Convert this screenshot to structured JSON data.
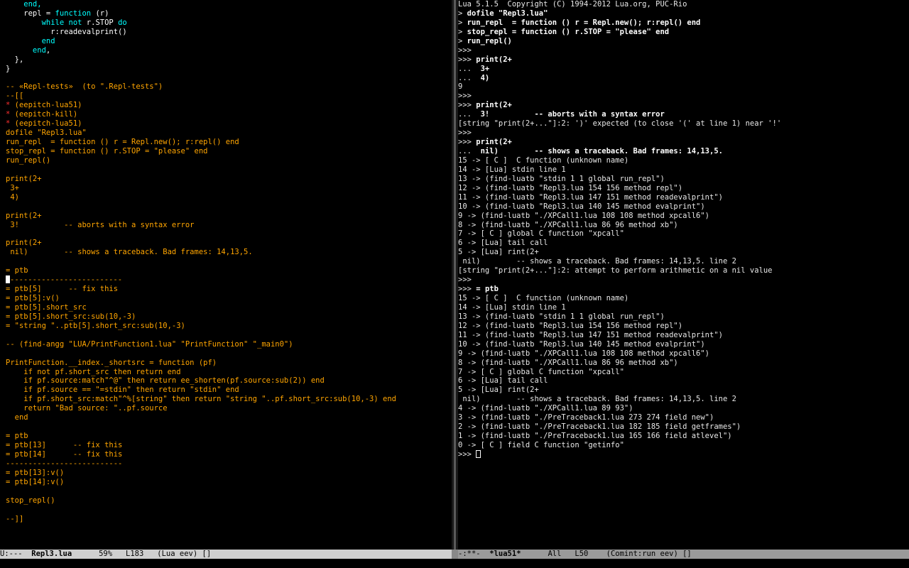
{
  "left_buffer": {
    "lines": [
      {
        "parts": [
          {
            "t": "    end,",
            "c": "c-kw"
          }
        ]
      },
      {
        "parts": [
          {
            "t": "    repl = ",
            "c": "c-code"
          },
          {
            "t": "function",
            "c": "c-kw"
          },
          {
            "t": " (r)",
            "c": "c-code"
          }
        ]
      },
      {
        "parts": [
          {
            "t": "        ",
            "c": "c-code"
          },
          {
            "t": "while not",
            "c": "c-kw"
          },
          {
            "t": " r.STOP ",
            "c": "c-code"
          },
          {
            "t": "do",
            "c": "c-kw"
          }
        ]
      },
      {
        "parts": [
          {
            "t": "          r:readevalprint()",
            "c": "c-code"
          }
        ]
      },
      {
        "parts": [
          {
            "t": "        end",
            "c": "c-kw"
          }
        ]
      },
      {
        "parts": [
          {
            "t": "      end",
            "c": "c-kw"
          },
          {
            "t": ",",
            "c": "c-code"
          }
        ]
      },
      {
        "parts": [
          {
            "t": "  },",
            "c": "c-code"
          }
        ]
      },
      {
        "parts": [
          {
            "t": "}",
            "c": "c-code"
          }
        ]
      },
      {
        "parts": [
          {
            "t": "",
            "c": "c-code"
          }
        ]
      },
      {
        "parts": [
          {
            "t": "-- «Repl-tests»  (to \".Repl-tests\")",
            "c": "c-com"
          }
        ]
      },
      {
        "parts": [
          {
            "t": "--[[",
            "c": "c-com"
          }
        ]
      },
      {
        "parts": [
          {
            "t": "*",
            "c": "c-red"
          },
          {
            "t": " (eepitch-lua51)",
            "c": "c-com"
          }
        ]
      },
      {
        "parts": [
          {
            "t": "*",
            "c": "c-red"
          },
          {
            "t": " (eepitch-kill)",
            "c": "c-com"
          }
        ]
      },
      {
        "parts": [
          {
            "t": "*",
            "c": "c-red"
          },
          {
            "t": " (eepitch-lua51)",
            "c": "c-com"
          }
        ]
      },
      {
        "parts": [
          {
            "t": "dofile \"Repl3.lua\"",
            "c": "c-com"
          }
        ]
      },
      {
        "parts": [
          {
            "t": "run_repl  = function () r = Repl.new(); r:repl() end",
            "c": "c-com"
          }
        ]
      },
      {
        "parts": [
          {
            "t": "stop_repl = function () r.STOP = \"please\" end",
            "c": "c-com"
          }
        ]
      },
      {
        "parts": [
          {
            "t": "run_repl()",
            "c": "c-com"
          }
        ]
      },
      {
        "parts": [
          {
            "t": "",
            "c": "c-com"
          }
        ]
      },
      {
        "parts": [
          {
            "t": "print(2+",
            "c": "c-com"
          }
        ]
      },
      {
        "parts": [
          {
            "t": " 3+",
            "c": "c-com"
          }
        ]
      },
      {
        "parts": [
          {
            "t": " 4)",
            "c": "c-com"
          }
        ]
      },
      {
        "parts": [
          {
            "t": "",
            "c": "c-com"
          }
        ]
      },
      {
        "parts": [
          {
            "t": "print(2+",
            "c": "c-com"
          }
        ]
      },
      {
        "parts": [
          {
            "t": " 3!          -- aborts with a syntax error",
            "c": "c-com"
          }
        ]
      },
      {
        "parts": [
          {
            "t": "",
            "c": "c-com"
          }
        ]
      },
      {
        "parts": [
          {
            "t": "print(2+",
            "c": "c-com"
          }
        ]
      },
      {
        "parts": [
          {
            "t": " nil)        -- shows a traceback. Bad frames: 14,13,5.",
            "c": "c-com"
          }
        ]
      },
      {
        "parts": [
          {
            "t": "",
            "c": "c-com"
          }
        ]
      },
      {
        "parts": [
          {
            "t": "= ptb",
            "c": "c-com"
          }
        ]
      },
      {
        "parts": [
          {
            "t": "",
            "c": "c-com",
            "cursor": true
          },
          {
            "t": "-------------------------",
            "c": "c-com"
          }
        ]
      },
      {
        "parts": [
          {
            "t": "= ptb[5]      -- fix this",
            "c": "c-com"
          }
        ]
      },
      {
        "parts": [
          {
            "t": "= ptb[5]:v()",
            "c": "c-com"
          }
        ]
      },
      {
        "parts": [
          {
            "t": "= ptb[5].short_src",
            "c": "c-com"
          }
        ]
      },
      {
        "parts": [
          {
            "t": "= ptb[5].short_src:sub(10,-3)",
            "c": "c-com"
          }
        ]
      },
      {
        "parts": [
          {
            "t": "= \"string \"..ptb[5].short_src:sub(10,-3)",
            "c": "c-com"
          }
        ]
      },
      {
        "parts": [
          {
            "t": "",
            "c": "c-com"
          }
        ]
      },
      {
        "parts": [
          {
            "t": "-- (find-angg \"LUA/PrintFunction1.lua\" \"PrintFunction\" \"_main0\")",
            "c": "c-com"
          }
        ]
      },
      {
        "parts": [
          {
            "t": "",
            "c": "c-com"
          }
        ]
      },
      {
        "parts": [
          {
            "t": "PrintFunction.__index._shortsrc = function (pf)",
            "c": "c-com"
          }
        ]
      },
      {
        "parts": [
          {
            "t": "    if not pf.short_src then return end",
            "c": "c-com"
          }
        ]
      },
      {
        "parts": [
          {
            "t": "    if pf.source:match\"^@\" then return ee_shorten(pf.source:sub(2)) end",
            "c": "c-com"
          }
        ]
      },
      {
        "parts": [
          {
            "t": "    if pf.source == \"=stdin\" then return \"stdin\" end",
            "c": "c-com"
          }
        ]
      },
      {
        "parts": [
          {
            "t": "    if pf.short_src:match\"^%[string\" then return \"string \"..pf.short_src:sub(10,-3) end",
            "c": "c-com"
          }
        ]
      },
      {
        "parts": [
          {
            "t": "    return \"Bad source: \"..pf.source",
            "c": "c-com"
          }
        ]
      },
      {
        "parts": [
          {
            "t": "  end",
            "c": "c-com"
          }
        ]
      },
      {
        "parts": [
          {
            "t": "",
            "c": "c-com"
          }
        ]
      },
      {
        "parts": [
          {
            "t": "= ptb",
            "c": "c-com"
          }
        ]
      },
      {
        "parts": [
          {
            "t": "= ptb[13]      -- fix this",
            "c": "c-com"
          }
        ]
      },
      {
        "parts": [
          {
            "t": "= ptb[14]      -- fix this",
            "c": "c-com"
          }
        ]
      },
      {
        "parts": [
          {
            "t": "--------------------------",
            "c": "c-com"
          }
        ]
      },
      {
        "parts": [
          {
            "t": "= ptb[13]:v()",
            "c": "c-com"
          }
        ]
      },
      {
        "parts": [
          {
            "t": "= ptb[14]:v()",
            "c": "c-com"
          }
        ]
      },
      {
        "parts": [
          {
            "t": "",
            "c": "c-com"
          }
        ]
      },
      {
        "parts": [
          {
            "t": "stop_repl()",
            "c": "c-com"
          }
        ]
      },
      {
        "parts": [
          {
            "t": "",
            "c": "c-com"
          }
        ]
      },
      {
        "parts": [
          {
            "t": "--]]",
            "c": "c-com"
          }
        ]
      }
    ]
  },
  "right_buffer": {
    "lines": [
      {
        "parts": [
          {
            "t": "Lua 5.1.5  Copyright (C) 1994-2012 Lua.org, PUC-Rio",
            "c": "c-out"
          }
        ]
      },
      {
        "parts": [
          {
            "t": "> ",
            "c": "c-out"
          },
          {
            "t": "dofile \"Repl3.lua\"",
            "c": "c-bold"
          }
        ]
      },
      {
        "parts": [
          {
            "t": "> ",
            "c": "c-out"
          },
          {
            "t": "run_repl  = function () r = Repl.new(); r:repl() end",
            "c": "c-bold"
          }
        ]
      },
      {
        "parts": [
          {
            "t": "> ",
            "c": "c-out"
          },
          {
            "t": "stop_repl = function () r.STOP = \"please\" end",
            "c": "c-bold"
          }
        ]
      },
      {
        "parts": [
          {
            "t": "> ",
            "c": "c-out"
          },
          {
            "t": "run_repl()",
            "c": "c-bold"
          }
        ]
      },
      {
        "parts": [
          {
            "t": ">>>",
            "c": "c-out"
          }
        ]
      },
      {
        "parts": [
          {
            "t": ">>> ",
            "c": "c-out"
          },
          {
            "t": "print(2+",
            "c": "c-bold"
          }
        ]
      },
      {
        "parts": [
          {
            "t": "...  ",
            "c": "c-out"
          },
          {
            "t": "3+",
            "c": "c-bold"
          }
        ]
      },
      {
        "parts": [
          {
            "t": "...  ",
            "c": "c-out"
          },
          {
            "t": "4)",
            "c": "c-bold"
          }
        ]
      },
      {
        "parts": [
          {
            "t": "9",
            "c": "c-out"
          }
        ]
      },
      {
        "parts": [
          {
            "t": ">>>",
            "c": "c-out"
          }
        ]
      },
      {
        "parts": [
          {
            "t": ">>> ",
            "c": "c-out"
          },
          {
            "t": "print(2+",
            "c": "c-bold"
          }
        ]
      },
      {
        "parts": [
          {
            "t": "...  ",
            "c": "c-out"
          },
          {
            "t": "3!          -- aborts with a syntax error",
            "c": "c-bold"
          }
        ]
      },
      {
        "parts": [
          {
            "t": "[string \"print(2+...\"]:2: ')' expected (to close '(' at line 1) near '!'",
            "c": "c-out"
          }
        ]
      },
      {
        "parts": [
          {
            "t": ">>>",
            "c": "c-out"
          }
        ]
      },
      {
        "parts": [
          {
            "t": ">>> ",
            "c": "c-out"
          },
          {
            "t": "print(2+",
            "c": "c-bold"
          }
        ]
      },
      {
        "parts": [
          {
            "t": "...  ",
            "c": "c-out"
          },
          {
            "t": "nil)        -- shows a traceback. Bad frames: 14,13,5.",
            "c": "c-bold"
          }
        ]
      },
      {
        "parts": [
          {
            "t": "15 -> [ C ]  C function (unknown name)",
            "c": "c-out"
          }
        ]
      },
      {
        "parts": [
          {
            "t": "14 -> [Lua] stdin line 1",
            "c": "c-out"
          }
        ]
      },
      {
        "parts": [
          {
            "t": "13 -> (find-luatb \"stdin 1 1 global run_repl\")",
            "c": "c-out"
          }
        ]
      },
      {
        "parts": [
          {
            "t": "12 -> (find-luatb \"Repl3.lua 154 156 method repl\")",
            "c": "c-out"
          }
        ]
      },
      {
        "parts": [
          {
            "t": "11 -> (find-luatb \"Repl3.lua 147 151 method readevalprint\")",
            "c": "c-out"
          }
        ]
      },
      {
        "parts": [
          {
            "t": "10 -> (find-luatb \"Repl3.lua 140 145 method evalprint\")",
            "c": "c-out"
          }
        ]
      },
      {
        "parts": [
          {
            "t": "9 -> (find-luatb \"./XPCall1.lua 108 108 method xpcall6\")",
            "c": "c-out"
          }
        ]
      },
      {
        "parts": [
          {
            "t": "8 -> (find-luatb \"./XPCall1.lua 86 96 method xb\")",
            "c": "c-out"
          }
        ]
      },
      {
        "parts": [
          {
            "t": "7 -> [ C ] global C function \"xpcall\"",
            "c": "c-out"
          }
        ]
      },
      {
        "parts": [
          {
            "t": "6 -> [Lua] tail call",
            "c": "c-out"
          }
        ]
      },
      {
        "parts": [
          {
            "t": "5 -> [Lua] rint(2+",
            "c": "c-out"
          }
        ]
      },
      {
        "parts": [
          {
            "t": " nil)        -- shows a traceback. Bad frames: 14,13,5. line 2",
            "c": "c-out"
          }
        ]
      },
      {
        "parts": [
          {
            "t": "[string \"print(2+...\"]:2: attempt to perform arithmetic on a nil value",
            "c": "c-out"
          }
        ]
      },
      {
        "parts": [
          {
            "t": ">>>",
            "c": "c-out"
          }
        ]
      },
      {
        "parts": [
          {
            "t": ">>> ",
            "c": "c-out"
          },
          {
            "t": "= ptb",
            "c": "c-bold"
          }
        ]
      },
      {
        "parts": [
          {
            "t": "15 -> [ C ]  C function (unknown name)",
            "c": "c-out"
          }
        ]
      },
      {
        "parts": [
          {
            "t": "14 -> [Lua] stdin line 1",
            "c": "c-out"
          }
        ]
      },
      {
        "parts": [
          {
            "t": "13 -> (find-luatb \"stdin 1 1 global run_repl\")",
            "c": "c-out"
          }
        ]
      },
      {
        "parts": [
          {
            "t": "12 -> (find-luatb \"Repl3.lua 154 156 method repl\")",
            "c": "c-out"
          }
        ]
      },
      {
        "parts": [
          {
            "t": "11 -> (find-luatb \"Repl3.lua 147 151 method readevalprint\")",
            "c": "c-out"
          }
        ]
      },
      {
        "parts": [
          {
            "t": "10 -> (find-luatb \"Repl3.lua 140 145 method evalprint\")",
            "c": "c-out"
          }
        ]
      },
      {
        "parts": [
          {
            "t": "9 -> (find-luatb \"./XPCall1.lua 108 108 method xpcall6\")",
            "c": "c-out"
          }
        ]
      },
      {
        "parts": [
          {
            "t": "8 -> (find-luatb \"./XPCall1.lua 86 96 method xb\")",
            "c": "c-out"
          }
        ]
      },
      {
        "parts": [
          {
            "t": "7 -> [ C ] global C function \"xpcall\"",
            "c": "c-out"
          }
        ]
      },
      {
        "parts": [
          {
            "t": "6 -> [Lua] tail call",
            "c": "c-out"
          }
        ]
      },
      {
        "parts": [
          {
            "t": "5 -> [Lua] rint(2+",
            "c": "c-out"
          }
        ]
      },
      {
        "parts": [
          {
            "t": " nil)        -- shows a traceback. Bad frames: 14,13,5. line 2",
            "c": "c-out"
          }
        ]
      },
      {
        "parts": [
          {
            "t": "4 -> (find-luatb \"./XPCall1.lua 89 93\")",
            "c": "c-out"
          }
        ]
      },
      {
        "parts": [
          {
            "t": "3 -> (find-luatb \"./PreTraceback1.lua 273 274 field new\")",
            "c": "c-out"
          }
        ]
      },
      {
        "parts": [
          {
            "t": "2 -> (find-luatb \"./PreTraceback1.lua 182 185 field getframes\")",
            "c": "c-out"
          }
        ]
      },
      {
        "parts": [
          {
            "t": "1 -> (find-luatb \"./PreTraceback1.lua 165 166 field atlevel\")",
            "c": "c-out"
          }
        ]
      },
      {
        "parts": [
          {
            "t": "0 -> [ C ] field C function \"getinfo\"",
            "c": "c-out"
          }
        ]
      },
      {
        "parts": [
          {
            "t": ">>> ",
            "c": "c-out",
            "cursor": true
          }
        ]
      }
    ]
  },
  "modeline_left": {
    "status": "U:---  ",
    "buffer": "Repl3.lua",
    "rest": "      59%   L183   (Lua eev) []"
  },
  "modeline_right": {
    "status": "-:**-  ",
    "buffer": "*lua51*",
    "rest": "      All   L50    (Comint:run eev) []"
  },
  "colors": {
    "background": "#000000",
    "code": "#ffffff",
    "keyword": "#00ffff",
    "comment": "#ffa500",
    "bullet": "#ff3030",
    "modeline_active": "#cfcfcf",
    "modeline_inactive": "#9a9a9a"
  }
}
